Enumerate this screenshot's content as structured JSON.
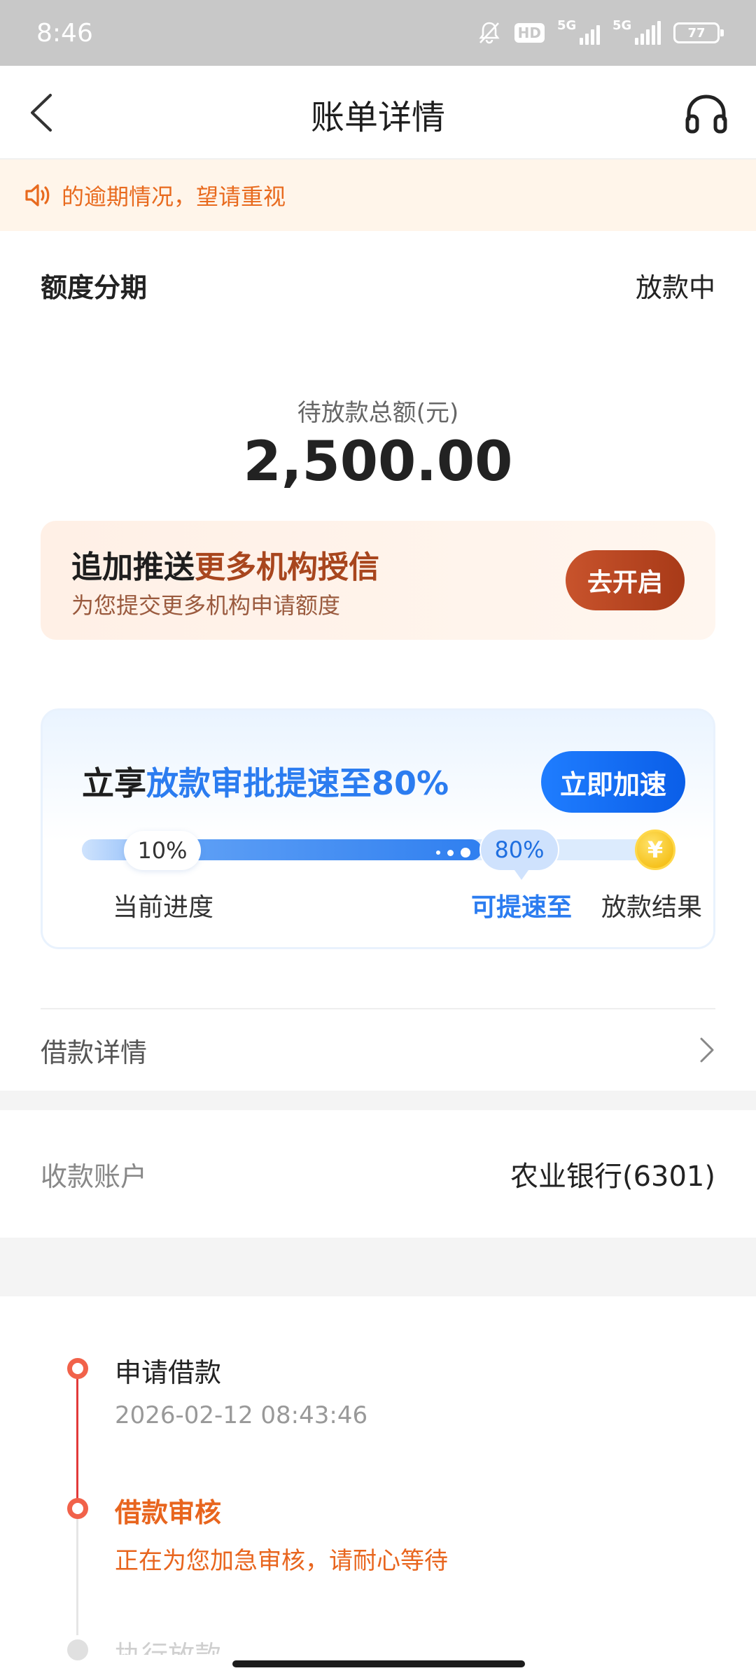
{
  "status_bar": {
    "time": "8:46",
    "hd_badge": "HD",
    "signal1_label": "5G",
    "signal2_label": "5G",
    "battery": "77"
  },
  "nav": {
    "title": "账单详情",
    "back_icon": "chevron-left-icon",
    "service_icon": "headset-icon"
  },
  "notice": {
    "icon": "speaker-icon",
    "text": "的逾期情况，望请重视",
    "color": "#e86a1e"
  },
  "order": {
    "product": "额度分期",
    "status": "放款中"
  },
  "amount": {
    "label": "待放款总额(元)",
    "value": "2,500.00"
  },
  "promo": {
    "title_prefix": "追加推送",
    "title_highlight": "更多机构授信",
    "subtitle": "为您提交更多机构申请额度",
    "button": "去开启",
    "accent": "#a8461e"
  },
  "speedup": {
    "title_prefix": "立享",
    "title_highlight": "放款审批提速至80%",
    "button": "立即加速",
    "current_percent": "10%",
    "target_percent": "80%",
    "progress_fill": 0.68,
    "current_label": "当前进度",
    "target_label": "可提速至",
    "result_label": "放款结果",
    "coin_symbol": "¥",
    "accent": "#2b7cf0"
  },
  "loan_details": {
    "label": "借款详情",
    "chevron_icon": "chevron-right-icon"
  },
  "account": {
    "label": "收款账户",
    "value": "农业银行(6301)"
  },
  "timeline": {
    "steps": [
      {
        "title": "申请借款",
        "subtitle": "2026-02-12 08:43:46",
        "state": "done"
      },
      {
        "title": "借款审核",
        "subtitle": "正在为您加急审核，请耐心等待",
        "state": "active"
      },
      {
        "title": "执行放款",
        "subtitle": "",
        "state": "pending"
      }
    ],
    "active_color": "#e8651e",
    "line_color": "#e23a3a"
  }
}
